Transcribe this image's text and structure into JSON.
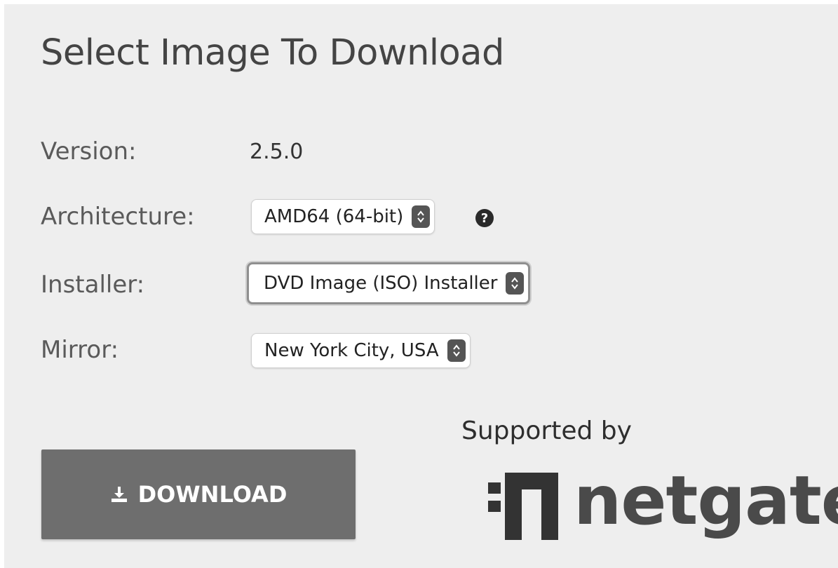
{
  "page": {
    "title": "Select Image To Download"
  },
  "form": {
    "version": {
      "label": "Version:",
      "value": "2.5.0"
    },
    "architecture": {
      "label": "Architecture:",
      "value": "AMD64 (64-bit)"
    },
    "installer": {
      "label": "Installer:",
      "value": "DVD Image (ISO) Installer"
    },
    "mirror": {
      "label": "Mirror:",
      "value": "New York City, USA"
    },
    "help_icon": "?"
  },
  "download_button": {
    "label": "DOWNLOAD",
    "icon": "download-icon"
  },
  "sponsor": {
    "supported_by": "Supported by",
    "logo_text": "netgate",
    "logo_icon": "netgate-logo-icon"
  },
  "colors": {
    "panel_bg": "#eeeeee",
    "button_bg": "#6e6e6e",
    "text_dark": "#444444"
  }
}
